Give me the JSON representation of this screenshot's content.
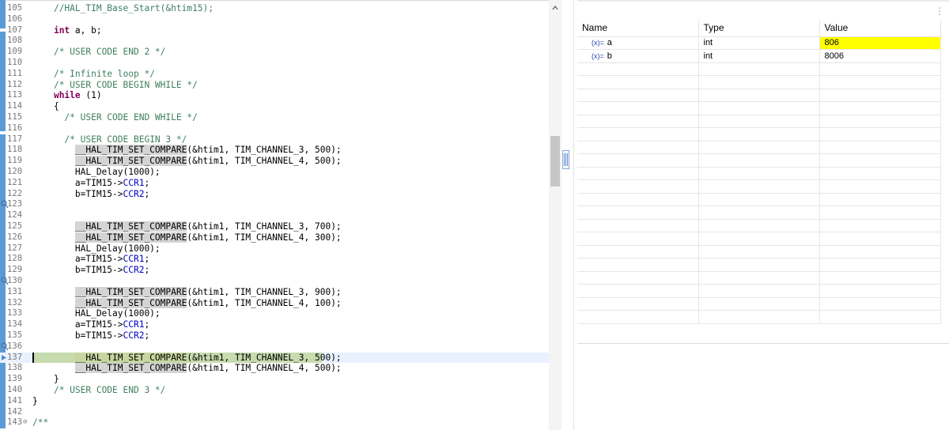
{
  "editor": {
    "lines": [
      {
        "num": "105",
        "tokens": [
          {
            "t": "    ",
            "c": ""
          },
          {
            "t": "//HAL_TIM_Base_Start(&htim15);",
            "c": "c-cm"
          }
        ]
      },
      {
        "num": "106",
        "tokens": []
      },
      {
        "num": "107",
        "tokens": [
          {
            "t": "    ",
            "c": ""
          },
          {
            "t": "int",
            "c": "c-kw"
          },
          {
            "t": " a, b;",
            "c": ""
          }
        ]
      },
      {
        "num": "108",
        "tokens": []
      },
      {
        "num": "109",
        "tokens": [
          {
            "t": "    ",
            "c": ""
          },
          {
            "t": "/* USER CODE END 2 */",
            "c": "c-cm"
          }
        ]
      },
      {
        "num": "110",
        "tokens": []
      },
      {
        "num": "111",
        "tokens": [
          {
            "t": "    ",
            "c": ""
          },
          {
            "t": "/* Infinite loop */",
            "c": "c-cm"
          }
        ]
      },
      {
        "num": "112",
        "tokens": [
          {
            "t": "    ",
            "c": ""
          },
          {
            "t": "/* USER CODE BEGIN WHILE */",
            "c": "c-cm"
          }
        ]
      },
      {
        "num": "113",
        "tokens": [
          {
            "t": "    ",
            "c": ""
          },
          {
            "t": "while",
            "c": "c-kw"
          },
          {
            "t": " (1)",
            "c": ""
          }
        ]
      },
      {
        "num": "114",
        "tokens": [
          {
            "t": "    {",
            "c": ""
          }
        ]
      },
      {
        "num": "115",
        "tokens": [
          {
            "t": "      ",
            "c": ""
          },
          {
            "t": "/* USER CODE END WHILE */",
            "c": "c-cm"
          }
        ]
      },
      {
        "num": "116",
        "tokens": []
      },
      {
        "num": "117",
        "tokens": [
          {
            "t": "      ",
            "c": ""
          },
          {
            "t": "/* USER CODE BEGIN 3 */",
            "c": "c-cm"
          }
        ]
      },
      {
        "num": "118",
        "tokens": [
          {
            "t": "        ",
            "c": ""
          },
          {
            "t": "__HAL_TIM_SET_COMPARE",
            "c": "c-mac"
          },
          {
            "t": "(&htim1, TIM_CHANNEL_3, 500);",
            "c": ""
          }
        ]
      },
      {
        "num": "119",
        "tokens": [
          {
            "t": "        ",
            "c": ""
          },
          {
            "t": "__HAL_TIM_SET_COMPARE",
            "c": "c-mac"
          },
          {
            "t": "(&htim1, TIM_CHANNEL_4, 500);",
            "c": ""
          }
        ]
      },
      {
        "num": "120",
        "tokens": [
          {
            "t": "        HAL_Delay(1000);",
            "c": ""
          }
        ]
      },
      {
        "num": "121",
        "tokens": [
          {
            "t": "        a=TIM15->",
            "c": ""
          },
          {
            "t": "CCR1",
            "c": "c-fld"
          },
          {
            "t": ";",
            "c": ""
          }
        ]
      },
      {
        "num": "122",
        "tokens": [
          {
            "t": "        b=TIM15->",
            "c": ""
          },
          {
            "t": "CCR2",
            "c": "c-fld"
          },
          {
            "t": ";",
            "c": ""
          }
        ]
      },
      {
        "num": "123",
        "bp": true,
        "tokens": []
      },
      {
        "num": "124",
        "tokens": []
      },
      {
        "num": "125",
        "tokens": [
          {
            "t": "        ",
            "c": ""
          },
          {
            "t": "__HAL_TIM_SET_COMPARE",
            "c": "c-mac"
          },
          {
            "t": "(&htim1, TIM_CHANNEL_3, 700);",
            "c": ""
          }
        ]
      },
      {
        "num": "126",
        "tokens": [
          {
            "t": "        ",
            "c": ""
          },
          {
            "t": "__HAL_TIM_SET_COMPARE",
            "c": "c-mac"
          },
          {
            "t": "(&htim1, TIM_CHANNEL_4, 300);",
            "c": ""
          }
        ]
      },
      {
        "num": "127",
        "tokens": [
          {
            "t": "        HAL_Delay(1000);",
            "c": ""
          }
        ]
      },
      {
        "num": "128",
        "tokens": [
          {
            "t": "        a=TIM15->",
            "c": ""
          },
          {
            "t": "CCR1",
            "c": "c-fld"
          },
          {
            "t": ";",
            "c": ""
          }
        ]
      },
      {
        "num": "129",
        "tokens": [
          {
            "t": "        b=TIM15->",
            "c": ""
          },
          {
            "t": "CCR2",
            "c": "c-fld"
          },
          {
            "t": ";",
            "c": ""
          }
        ]
      },
      {
        "num": "130",
        "bp": true,
        "tokens": []
      },
      {
        "num": "131",
        "tokens": [
          {
            "t": "        ",
            "c": ""
          },
          {
            "t": "__HAL_TIM_SET_COMPARE",
            "c": "c-mac"
          },
          {
            "t": "(&htim1, TIM_CHANNEL_3, 900);",
            "c": ""
          }
        ]
      },
      {
        "num": "132",
        "tokens": [
          {
            "t": "        ",
            "c": ""
          },
          {
            "t": "__HAL_TIM_SET_COMPARE",
            "c": "c-mac"
          },
          {
            "t": "(&htim1, TIM_CHANNEL_4, 100);",
            "c": ""
          }
        ]
      },
      {
        "num": "133",
        "tokens": [
          {
            "t": "        HAL_Delay(1000);",
            "c": ""
          }
        ]
      },
      {
        "num": "134",
        "tokens": [
          {
            "t": "        a=TIM15->",
            "c": ""
          },
          {
            "t": "CCR1",
            "c": "c-fld"
          },
          {
            "t": ";",
            "c": ""
          }
        ]
      },
      {
        "num": "135",
        "tokens": [
          {
            "t": "        b=TIM15->",
            "c": ""
          },
          {
            "t": "CCR2",
            "c": "c-fld"
          },
          {
            "t": ";",
            "c": ""
          }
        ]
      },
      {
        "num": "136",
        "bp": true,
        "tokens": []
      },
      {
        "num": "137",
        "exec": true,
        "current": true,
        "tokens": [
          {
            "t": "        ",
            "c": ""
          },
          {
            "t": "__HAL_TIM_SET_COMPARE",
            "c": "c-mac-hl"
          },
          {
            "t": "(&htim1, TIM_CHANNEL_3, 500);",
            "c": ""
          }
        ]
      },
      {
        "num": "138",
        "tokens": [
          {
            "t": "        ",
            "c": ""
          },
          {
            "t": "__HAL_TIM_SET_COMPARE",
            "c": "c-mac"
          },
          {
            "t": "(&htim1, TIM_CHANNEL_4, 500);",
            "c": ""
          }
        ]
      },
      {
        "num": "139",
        "tokens": [
          {
            "t": "    }",
            "c": ""
          }
        ]
      },
      {
        "num": "140",
        "tokens": [
          {
            "t": "    ",
            "c": ""
          },
          {
            "t": "/* USER CODE END 3 */",
            "c": "c-cm"
          }
        ]
      },
      {
        "num": "141",
        "tokens": [
          {
            "t": "}",
            "c": ""
          }
        ]
      },
      {
        "num": "142",
        "tokens": []
      },
      {
        "num": "143",
        "fold": true,
        "tokens": [
          {
            "t": "/**",
            "c": "c-cm"
          }
        ]
      }
    ]
  },
  "variables": {
    "columns": [
      "Name",
      "Type",
      "Value"
    ],
    "rows": [
      {
        "icon": "(x)=",
        "name": "a",
        "type": "int",
        "value": "806",
        "changed": true
      },
      {
        "icon": "(x)=",
        "name": "b",
        "type": "int",
        "value": "8006",
        "changed": false
      }
    ],
    "empty_rows": 20
  },
  "colors": {
    "comment": "#3f7f5f",
    "keyword": "#7f0055",
    "field": "#0000c0",
    "changed_value": "#ffff00",
    "exec_line": "#c6dbae",
    "ruler": "#5b9bd5"
  }
}
